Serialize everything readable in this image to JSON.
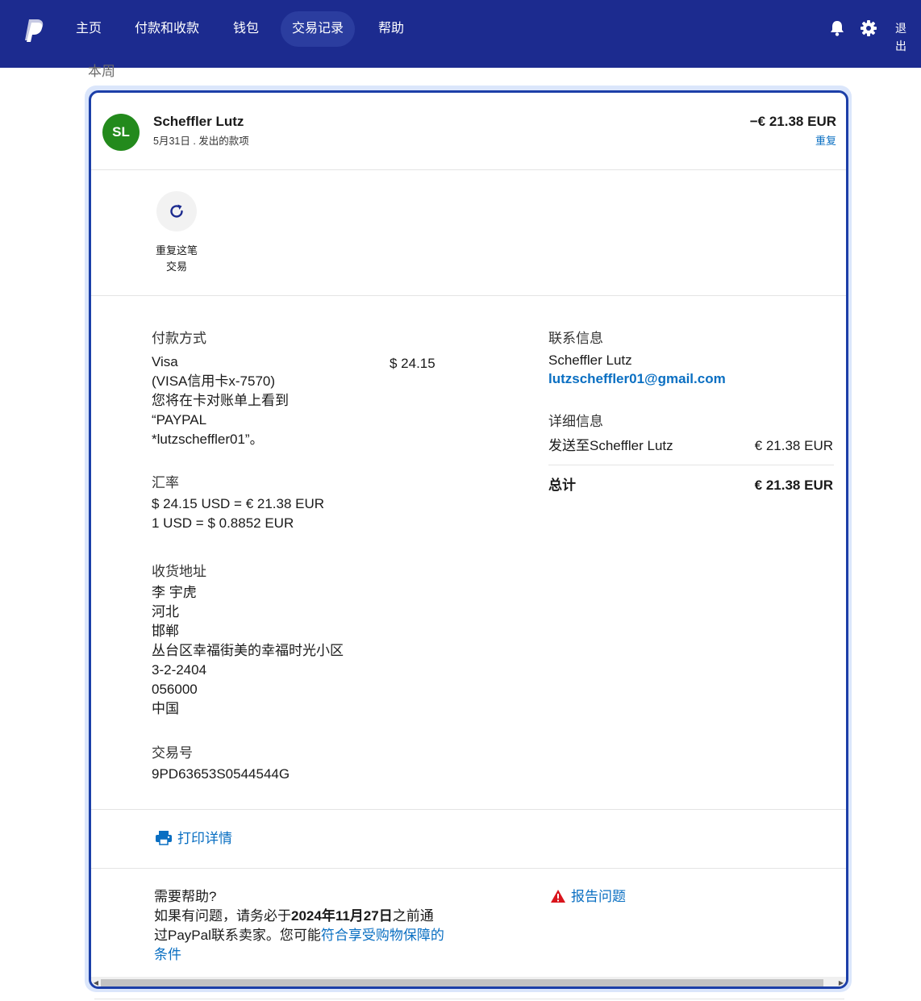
{
  "nav": {
    "logo_icon": "paypal-logo",
    "items": [
      {
        "label": "主页"
      },
      {
        "label": "付款和收款"
      },
      {
        "label": "钱包"
      },
      {
        "label": "交易记录"
      },
      {
        "label": "帮助"
      }
    ],
    "active_index": 3,
    "logout_label": "退出",
    "icons": [
      "bell-icon",
      "gear-icon"
    ]
  },
  "week_label": "本周",
  "transaction": {
    "avatar_initials": "SL",
    "avatar_color": "#238a1c",
    "merchant": "Scheffler Lutz",
    "subline": "5月31日 . 发出的款项",
    "amount": "−€ 21.38 EUR",
    "repeat_link": "重复",
    "repeat_action_label_1": "重复这笔",
    "repeat_action_label_2": "交易"
  },
  "payment": {
    "title": "付款方式",
    "method": "Visa",
    "card": "(VISA信用卡x-7570)",
    "statement_line1": "您将在卡对账单上看到",
    "statement_line2": "“PAYPAL",
    "statement_line3": "*lutzscheffler01”。",
    "amount": "$ 24.15"
  },
  "exchange": {
    "title": "汇率",
    "line1": "$ 24.15 USD = € 21.38 EUR",
    "line2": "1 USD = $ 0.8852 EUR"
  },
  "shipping": {
    "title": "收货地址",
    "lines": [
      "李 宇虎",
      "河北",
      "邯郸",
      "丛台区幸福街美的幸福时光小区",
      "3-2-2404",
      "056000",
      "中国"
    ]
  },
  "transaction_id": {
    "title": "交易号",
    "value": "9PD63653S0544544G"
  },
  "contact": {
    "title": "联系信息",
    "name": "Scheffler Lutz",
    "email": "lutzscheffler01@gmail.com"
  },
  "details": {
    "title": "详细信息",
    "sent_to_label": "发送至Scheffler Lutz",
    "sent_amount": "€ 21.38 EUR",
    "total_label": "总计",
    "total_amount": "€ 21.38 EUR"
  },
  "print_label": "打印详情",
  "help": {
    "title": "需要帮助?",
    "text_pre": "如果有问题，请务必于",
    "date_bold": "2024年11月27日",
    "text_mid": "之前通过PayPal联系卖家。您可能",
    "link": "符合享受购物保障的条件",
    "report": "报告问题"
  },
  "colors": {
    "nav_bg": "#1c2b8f",
    "link": "#0a6fc2",
    "card_border": "#1c3fa8",
    "warning": "#d9141c"
  }
}
